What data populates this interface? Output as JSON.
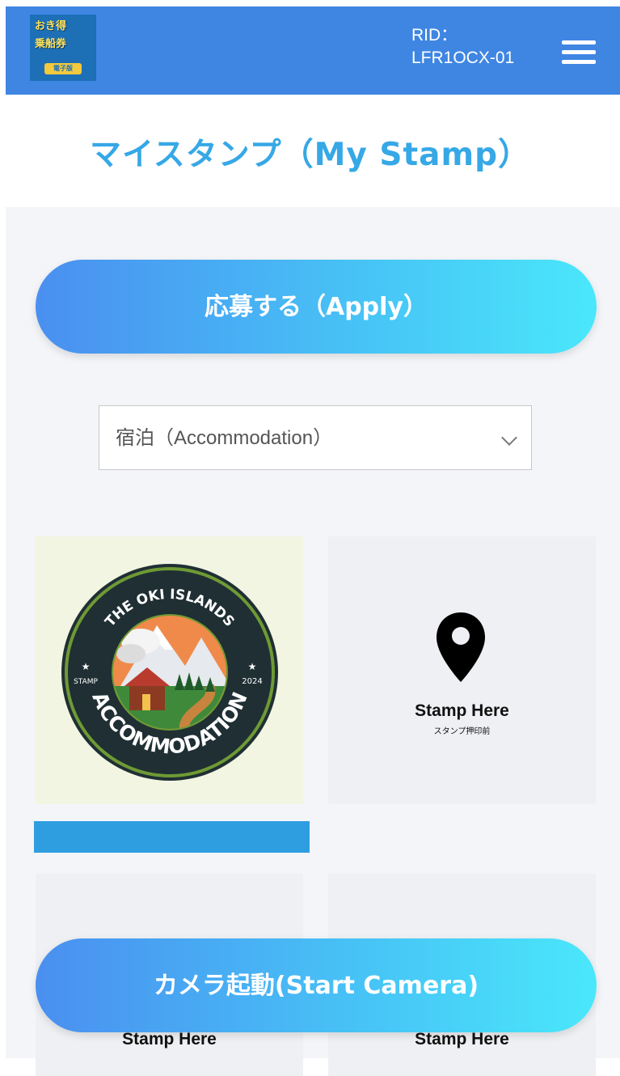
{
  "header": {
    "logo": {
      "line1": "おき得",
      "line2": "乗船券",
      "badge": "電子版"
    },
    "rid_label": "RID：",
    "rid_value": "LFR1OCX-01"
  },
  "page_title": "マイスタンプ（My Stamp）",
  "apply_button": "応募する（Apply）",
  "category_select": {
    "selected": "宿泊（Accommodation）"
  },
  "stamps": [
    {
      "status": "collected",
      "badge": {
        "top_text": "THE OKI ISLANDS",
        "bottom_text": "ACCOMMODATION",
        "left_text": "STAMP",
        "right_text": "2024"
      }
    },
    {
      "status": "empty",
      "label": "Stamp Here",
      "sublabel": "スタンプ押印前"
    },
    {
      "status": "empty",
      "label": "Stamp Here"
    },
    {
      "status": "empty",
      "label": "Stamp Here"
    }
  ],
  "camera_button": "カメラ起動(Start Camera)",
  "colors": {
    "header": "#3f86e3",
    "title": "#36a8e6",
    "button_gradient_start": "#4a8ff0",
    "button_gradient_end": "#4ae7fb",
    "progress": "#2f9ee0",
    "background": "#f3f5f8"
  },
  "icons": [
    "menu-icon",
    "chevron-down-icon",
    "location-pin-icon"
  ]
}
